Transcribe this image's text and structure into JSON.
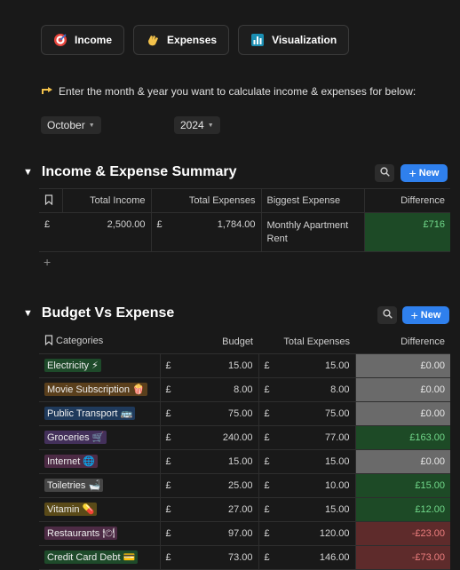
{
  "nav": {
    "buttons": [
      {
        "label": "Income",
        "icon": "target-icon"
      },
      {
        "label": "Expenses",
        "icon": "waving-hand-icon"
      },
      {
        "label": "Visualization",
        "icon": "bar-chart-icon"
      }
    ]
  },
  "prompt": {
    "text": "Enter the month & year you want to calculate income & expenses for below:"
  },
  "selectors": {
    "month": "October",
    "year": "2024"
  },
  "summary": {
    "title": "Income & Expense Summary",
    "new_label": "New",
    "columns": [
      "Total Income",
      "Total Expenses",
      "Biggest Expense",
      "Difference"
    ],
    "row": {
      "income_currency": "£",
      "income": "2,500.00",
      "expenses_currency": "£",
      "expenses": "1,784.00",
      "biggest_expense": "Monthly Apartment Rent",
      "difference": "£716"
    }
  },
  "budget": {
    "title": "Budget Vs Expense",
    "new_label": "New",
    "columns": [
      "Categories",
      "Budget",
      "Total Expenses",
      "Difference"
    ],
    "rows": [
      {
        "category": "Electricity ⚡",
        "tag_color": "#1e4a2a",
        "cur1": "£",
        "budget": "15.00",
        "cur2": "£",
        "expenses": "15.00",
        "difference": "£0.00",
        "status": "grey"
      },
      {
        "category": "Movie Subscription 🍿",
        "tag_color": "#5a3f1c",
        "cur1": "£",
        "budget": "8.00",
        "cur2": "£",
        "expenses": "8.00",
        "difference": "£0.00",
        "status": "grey"
      },
      {
        "category": "Public Transport 🚌",
        "tag_color": "#1f3a5c",
        "cur1": "£",
        "budget": "75.00",
        "cur2": "£",
        "expenses": "75.00",
        "difference": "£0.00",
        "status": "grey"
      },
      {
        "category": "Groceries 🛒",
        "tag_color": "#43305a",
        "cur1": "£",
        "budget": "240.00",
        "cur2": "£",
        "expenses": "77.00",
        "difference": "£163.00",
        "status": "green"
      },
      {
        "category": "Internet 🌐",
        "tag_color": "#4d2b45",
        "cur1": "£",
        "budget": "15.00",
        "cur2": "£",
        "expenses": "15.00",
        "difference": "£0.00",
        "status": "grey"
      },
      {
        "category": "Toiletries 🛁",
        "tag_color": "#454545",
        "cur1": "£",
        "budget": "25.00",
        "cur2": "£",
        "expenses": "10.00",
        "difference": "£15.00",
        "status": "green"
      },
      {
        "category": "Vitamin 💊",
        "tag_color": "#5a4a18",
        "cur1": "£",
        "budget": "27.00",
        "cur2": "£",
        "expenses": "15.00",
        "difference": "£12.00",
        "status": "green"
      },
      {
        "category": "Restaurants 🍽",
        "tag_color": "#4d2b45",
        "cur1": "£",
        "budget": "97.00",
        "cur2": "£",
        "expenses": "120.00",
        "difference": "-£23.00",
        "status": "red"
      },
      {
        "category": "Credit Card Debt 💳",
        "tag_color": "#1e4a2a",
        "cur1": "£",
        "budget": "73.00",
        "cur2": "£",
        "expenses": "146.00",
        "difference": "-£73.00",
        "status": "red"
      }
    ]
  },
  "colors": {
    "accent": "#2f80ed",
    "positive_bg": "#1d4a26",
    "neutral_bg": "#6a6a6a",
    "negative_bg": "#5e2b2b"
  }
}
